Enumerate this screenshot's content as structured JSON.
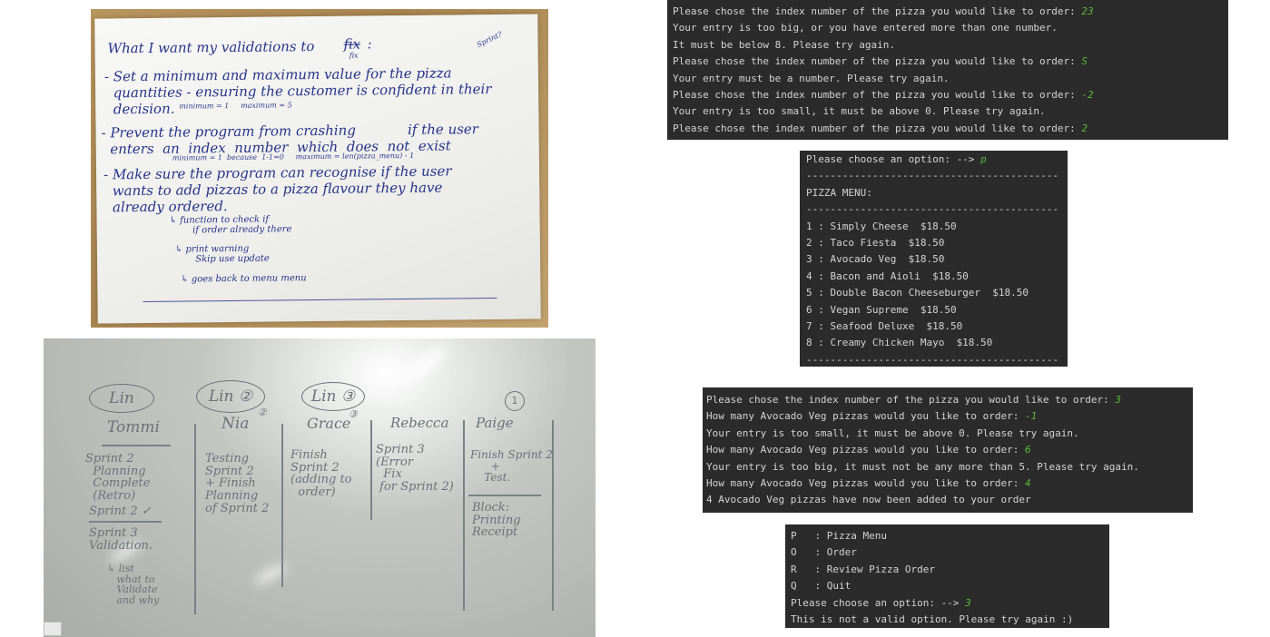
{
  "paper_note": {
    "title": "What I want my validations to",
    "title_crossed": "fix",
    "title_correction": "fix",
    "title_colon": ":",
    "corner_note": "Sprint?",
    "bullet_1": "- Set a minimum and maximum value for the pizza\n  quantities - ensuring the customer is confident in their\n  decision.",
    "bullet_1_note": "minimum = 1     maximum = 5",
    "bullet_2": "- Prevent the program from crashing            if the user\n  enters  an  index  number  which  does  not  exist",
    "bullet_2_note": "minimum = 1  because  1-1=0     maximum = len(pizza_menu) - 1",
    "bullet_3": "- Make sure the program can recognise if the user\n  wants to add pizzas to a pizza flavour they have\n  already ordered.",
    "sub_1": "↳ function to check if\n        if order already there",
    "sub_2": "↳ print warning\n       Skip use update",
    "sub_3": "↳ goes back to menu menu"
  },
  "whiteboard": {
    "lin_1": "Lin",
    "lin_2": "Lin ②",
    "lin_3": "Lin ③",
    "circle_1": "1",
    "names": [
      "Tommi",
      "Nia",
      "Grace",
      "Rebecca",
      "Paige"
    ],
    "name_marks": [
      "",
      "②",
      "③",
      "",
      ""
    ],
    "tommi_tasks": "Sprint 2\n  Planning\n  Complete\n  (Retro)",
    "tommi_sprint2": "Sprint 2 ✓",
    "tommi_sprint3": "Sprint 3\nValidation.",
    "tommi_sub": "↳ list\n   what to\n   Validate\n   and why",
    "nia_tasks": "Testing\nSprint 2\n+ Finish\nPlanning\nof Sprint 2",
    "grace_tasks": "Finish\nSprint 2\n(adding to\n  order)",
    "rebecca_tasks": "Sprint 3\n(Error\n  Fix\n for Sprint 2)",
    "paige_tasks": "Finish Sprint 2\n      +\n    Test.",
    "paige_block": "Block:\nPrinting\nReceipt"
  },
  "terminals": {
    "order_index": [
      {
        "text": "Please chose the index number of the pizza you would like to order: ",
        "input": "23"
      },
      {
        "text": "Your entry is too big, or you have entered more than one number.",
        "input": ""
      },
      {
        "text": "It must be below 8. Please try again.",
        "input": ""
      },
      {
        "text": "Please chose the index number of the pizza you would like to order: ",
        "input": "S"
      },
      {
        "text": "Your entry must be a number. Please try again.",
        "input": ""
      },
      {
        "text": "Please chose the index number of the pizza you would like to order: ",
        "input": "-2"
      },
      {
        "text": "Your entry is too small, it must be above 0. Please try again.",
        "input": ""
      },
      {
        "text": "Please chose the index number of the pizza you would like to order: ",
        "input": "2"
      }
    ],
    "menu_prompt": {
      "text": "Please choose an option: --> ",
      "input": "p"
    },
    "menu_rule": "------------------------------------------",
    "menu_title": "PIZZA MENU:",
    "menu_items": [
      "1 : Simply Cheese  $18.50",
      "2 : Taco Fiesta  $18.50",
      "3 : Avocado Veg  $18.50",
      "4 : Bacon and Aioli  $18.50",
      "5 : Double Bacon Cheeseburger  $18.50",
      "6 : Vegan Supreme  $18.50",
      "7 : Seafood Deluxe  $18.50",
      "8 : Creamy Chicken Mayo  $18.50"
    ],
    "quantity": [
      {
        "text": "Please chose the index number of the pizza you would like to order: ",
        "input": "3"
      },
      {
        "text": "How many Avocado Veg pizzas would you like to order: ",
        "input": "-1"
      },
      {
        "text": "Your entry is too small, it must be above 0. Please try again.",
        "input": ""
      },
      {
        "text": "How many Avocado Veg pizzas would you like to order: ",
        "input": "6"
      },
      {
        "text": "Your entry is too big, it must not be any more than 5. Please try again.",
        "input": ""
      },
      {
        "text": "How many Avocado Veg pizzas would you like to order: ",
        "input": "4"
      },
      {
        "text": "4 Avocado Veg pizzas have now been added to your order",
        "input": ""
      }
    ],
    "options": [
      {
        "text": "P   : Pizza Menu",
        "input": ""
      },
      {
        "text": "O   : Order",
        "input": ""
      },
      {
        "text": "R   : Review Pizza Order",
        "input": ""
      },
      {
        "text": "Q   : Quit",
        "input": ""
      },
      {
        "text": "Please choose an option: --> ",
        "input": "3"
      },
      {
        "text": "This is not a valid option. Please try again :)",
        "input": ""
      }
    ]
  },
  "colors": {
    "terminal_bg": "#2b2b2b",
    "terminal_text": "#d4d4d4",
    "terminal_input": "#5cba3c",
    "ink": "#27348b"
  }
}
